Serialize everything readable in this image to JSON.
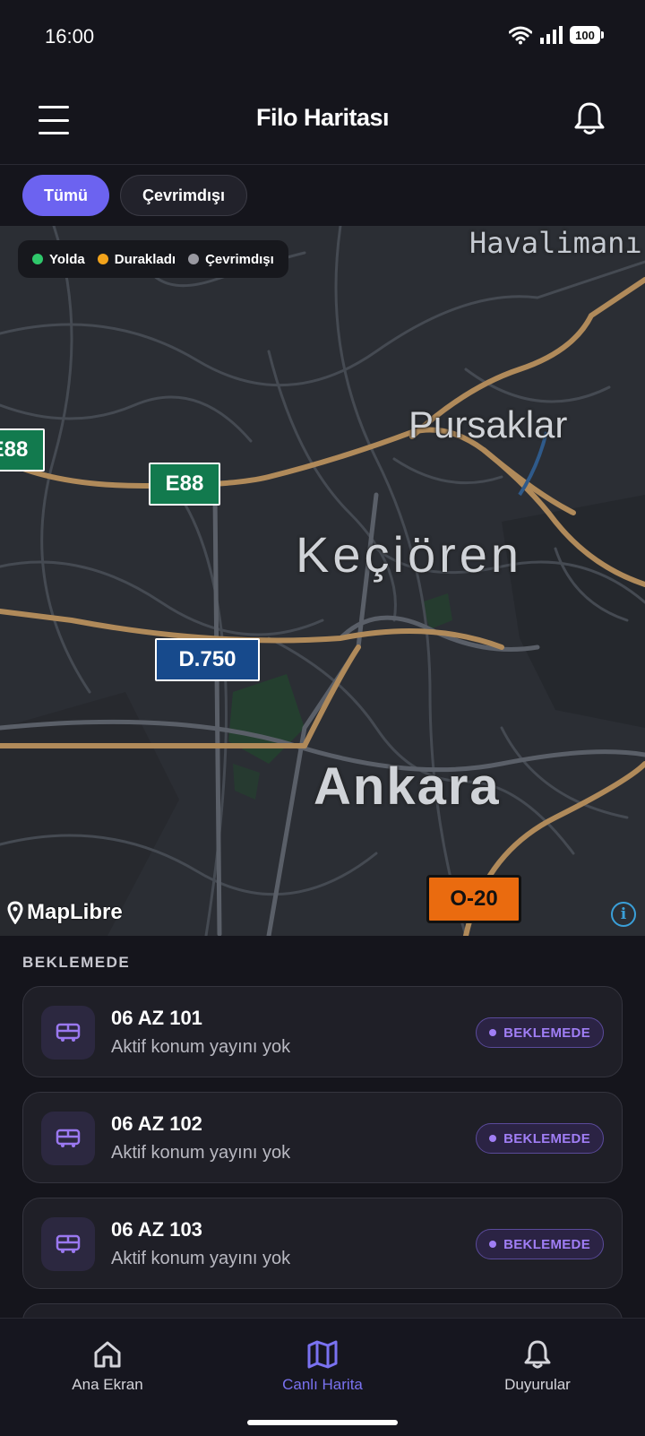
{
  "status_bar": {
    "time": "16:00",
    "battery": "100"
  },
  "header": {
    "title": "Filo Haritası"
  },
  "filters": [
    {
      "label": "Tümü",
      "active": true
    },
    {
      "label": "Çevrimdışı",
      "active": false
    }
  ],
  "map": {
    "legend": [
      {
        "label": "Yolda",
        "color": "#2fc86b"
      },
      {
        "label": "Durakladı",
        "color": "#f2a31b"
      },
      {
        "label": "Çevrimdışı",
        "color": "#9a9aa2"
      }
    ],
    "places": {
      "havalimani": "Havalimanı",
      "pursaklar": "Pursaklar",
      "kecioren": "Keçiören",
      "ankara": "Ankara"
    },
    "shields": {
      "e88_left": "E88",
      "e88": "E88",
      "d750": "D.750",
      "o20": "O-20"
    },
    "attribution": "MapLibre"
  },
  "list": {
    "section_title": "BEKLEMEDE",
    "items": [
      {
        "plate": "06 AZ 101",
        "subtitle": "Aktif konum yayını yok",
        "status": "BEKLEMEDE"
      },
      {
        "plate": "06 AZ 102",
        "subtitle": "Aktif konum yayını yok",
        "status": "BEKLEMEDE"
      },
      {
        "plate": "06 AZ 103",
        "subtitle": "Aktif konum yayını yok",
        "status": "BEKLEMEDE"
      }
    ]
  },
  "bottom_nav": [
    {
      "label": "Ana Ekran",
      "icon": "home-icon",
      "active": false
    },
    {
      "label": "Canlı Harita",
      "icon": "map-icon",
      "active": true
    },
    {
      "label": "Duyurular",
      "icon": "bell-icon",
      "active": false
    }
  ],
  "colors": {
    "accent": "#6c63f0",
    "badge": "#a07ef5",
    "road_major": "#b08a5a"
  }
}
